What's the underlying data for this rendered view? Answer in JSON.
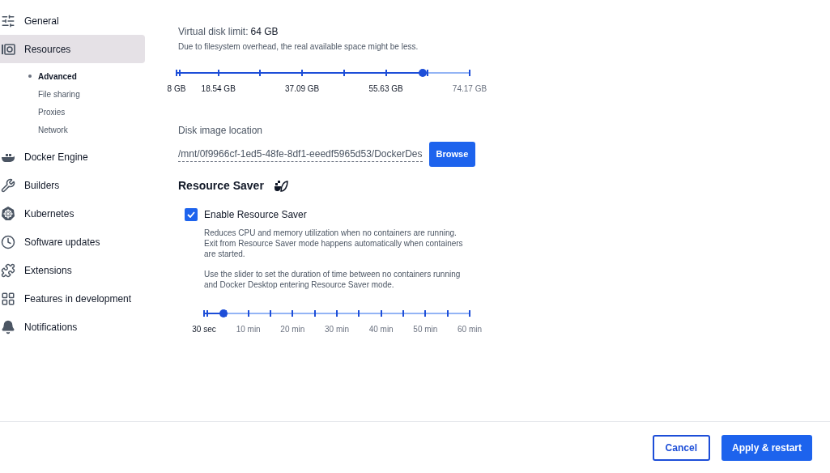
{
  "sidebar": {
    "items": [
      {
        "label": "General",
        "kind": "sliders",
        "selected": false
      },
      {
        "label": "Resources",
        "kind": "resources",
        "selected": true,
        "children": [
          {
            "label": "Advanced",
            "selected": true
          },
          {
            "label": "File sharing",
            "selected": false
          },
          {
            "label": "Proxies",
            "selected": false
          },
          {
            "label": "Network",
            "selected": false
          }
        ]
      },
      {
        "label": "Docker Engine",
        "kind": "whale",
        "selected": false
      },
      {
        "label": "Builders",
        "kind": "wrench",
        "selected": false
      },
      {
        "label": "Kubernetes",
        "kind": "helm",
        "selected": false
      },
      {
        "label": "Software updates",
        "kind": "clock",
        "selected": false
      },
      {
        "label": "Extensions",
        "kind": "puzzle",
        "selected": false
      },
      {
        "label": "Features in development",
        "kind": "grid",
        "selected": false
      },
      {
        "label": "Notifications",
        "kind": "bell",
        "selected": false
      }
    ]
  },
  "disk": {
    "label": "Virtual disk limit:",
    "value": "64 GB",
    "hint": "Due to filesystem overhead, the real available space might be less.",
    "slider": {
      "level": 0.84,
      "labels": [
        {
          "text": "8 GB",
          "reached": true
        },
        {
          "text": "18.54 GB",
          "reached": true
        },
        {
          "text": "37.09 GB",
          "reached": true
        },
        {
          "text": "55.63 GB",
          "reached": true
        },
        {
          "text": "74.17 GB",
          "reached": false
        }
      ]
    }
  },
  "location": {
    "label": "Disk image location",
    "value": "/mnt/0f9966cf-1ed5-48fe-8df1-eeedf5965d53/DockerDes",
    "button": "Browse"
  },
  "saver": {
    "title": "Resource Saver",
    "checkbox": {
      "label": "Enable Resource Saver",
      "checked": true
    },
    "description": "Reduces CPU and memory utilization when no containers are running. Exit from Resource Saver mode happens automatically when containers are started.",
    "hint": "Use the slider to set the duration of time between no containers running and Docker Desktop entering Resource Saver mode.",
    "slider": {
      "level": 0.073,
      "labels": [
        {
          "text": "30 sec",
          "reached": true
        },
        {
          "text": "10 min",
          "reached": false
        },
        {
          "text": "20 min",
          "reached": false
        },
        {
          "text": "30 min",
          "reached": false
        },
        {
          "text": "40 min",
          "reached": false
        },
        {
          "text": "50 min",
          "reached": false
        },
        {
          "text": "60 min",
          "reached": false
        }
      ]
    }
  },
  "footer": {
    "buttons": [
      {
        "label": "Cancel",
        "kind": "secondary"
      },
      {
        "label": "Apply & restart",
        "kind": "primary"
      }
    ]
  }
}
